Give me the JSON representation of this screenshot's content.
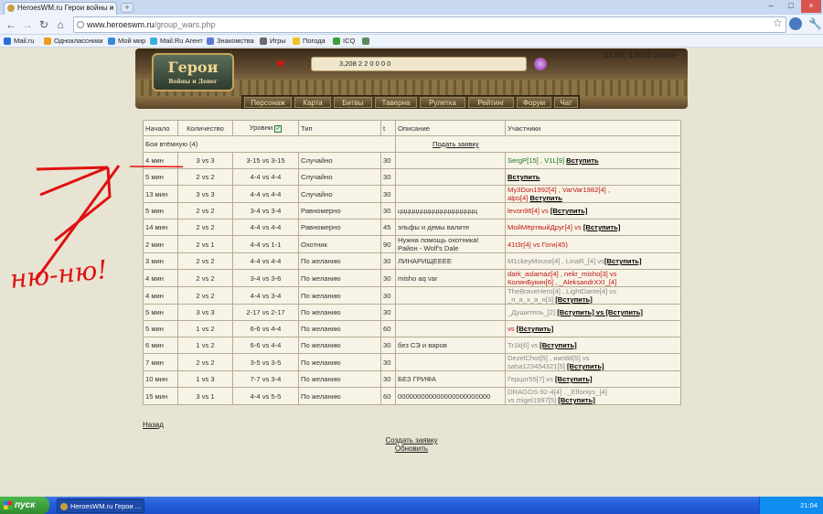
{
  "browser": {
    "tab_title": "HeroesWM.ru Герои войны и",
    "url_domain": "www.heroeswm.ru",
    "url_path": "/group_wars.php"
  },
  "bookmarks": [
    "Mail.ru",
    "Одноклассники",
    "Мой мир",
    "Mail.Ru Агент",
    "Знакомства",
    "Игры",
    "Погода",
    "ICQ"
  ],
  "header": {
    "logo": "Герои",
    "logo_sub": "Войны и Денег",
    "resources": "3,208   2   2   0   0   0   0",
    "clock": "21:03, 14815 online"
  },
  "menu": [
    "Персонаж",
    "Карта",
    "Битвы",
    "Таверна",
    "Рулетка",
    "Рейтинг",
    "Форум",
    "Чат"
  ],
  "table": {
    "headers": [
      "Начало",
      "Количество",
      "Уровни",
      "Тип",
      "t",
      "Описание",
      "Участники"
    ],
    "group_label": "Бои втёмную (4)",
    "submit_label": "Подать заявку",
    "rows": [
      {
        "start": "4 мин",
        "count": "3 vs 3",
        "levels": "3-15 vs 3-15",
        "type": "Случайно",
        "t": "30",
        "desc": "",
        "p": "SergP[15] , V1L[9] ",
        "join": "Вступить"
      },
      {
        "start": "5 мин",
        "count": "2 vs 2",
        "levels": "4-4 vs 4-4",
        "type": "Случайно",
        "t": "30",
        "desc": "",
        "p": "",
        "join": "Вступить"
      },
      {
        "start": "13 мин",
        "count": "3 vs 3",
        "levels": "4-4 vs 4-4",
        "type": "Случайно",
        "t": "30",
        "desc": "",
        "p": "My3Don1992[4] , VarVar1982[4] ,",
        "p2": "alps[4] ",
        "join": "Вступить"
      },
      {
        "start": "5 мин",
        "count": "2 vs 2",
        "levels": "3-4 vs 3-4",
        "type": "Равномерно",
        "t": "30",
        "desc": "цццццццццццццццццццц",
        "p": "levon96[4]  vs ",
        "join": "[Вступить]"
      },
      {
        "start": "14 мин",
        "count": "2 vs 2",
        "levels": "4-4 vs 4-4",
        "type": "Равномерно",
        "t": "45",
        "desc": "эльфы и демы валите",
        "p": "МойМёртвыйДруг[4]  vs ",
        "join": "[Вступить]"
      },
      {
        "start": "2 мин",
        "count": "2 vs 1",
        "levels": "4-4 vs 1-1",
        "type": "Охотник",
        "t": "90",
        "desc": "Нужна помощь охотника!",
        "desc2": "Район - Wolf's Dale",
        "p": "41t3r[4]  vs Гоги(45)",
        "join": ""
      },
      {
        "start": "3 мин",
        "count": "2 vs 2",
        "levels": "4-4 vs 4-4",
        "type": "По желанию",
        "t": "30",
        "desc": "ЛИНАРИЩЕЕЕЕ",
        "p": "M1ckeyMouse[4] , LinaR_[4]  vs",
        "join": "[Вступить]"
      },
      {
        "start": "4 мин",
        "count": "2 vs 2",
        "levels": "3-4 vs 3-6",
        "type": "По желанию",
        "t": "30",
        "desc": "misho aq var",
        "p": "dark_aslamaz[4] , nekr_misho[3]  vs",
        "p2": "КолянБукин[6] , _AleksandrXXI_[4] ",
        "join": ""
      },
      {
        "start": "4 мин",
        "count": "2 vs 2",
        "levels": "4-4 vs 3-4",
        "type": "По желанию",
        "t": "30",
        "desc": "",
        "p": "TheBraveHero[4] , LightDante[4]  vs",
        "p2": "_п_а_х_а_н[3]  ",
        "join": "[Вступить]"
      },
      {
        "start": "5 мин",
        "count": "3 vs 3",
        "levels": "2-17 vs 2-17",
        "type": "По желанию",
        "t": "30",
        "desc": "",
        "p": "_Душитель_[2]  ",
        "join": "[Вступить] vs [Вступить]"
      },
      {
        "start": "5 мин",
        "count": "1 vs 2",
        "levels": "6-6 vs 4-4",
        "type": "По желанию",
        "t": "60",
        "desc": "",
        "p": "vs ",
        "join": "[Вступить]"
      },
      {
        "start": "6 мин",
        "count": "1 vs 2",
        "levels": "6-6 vs 4-4",
        "type": "По желанию",
        "t": "30",
        "desc": "без СЭ и варов",
        "p": "Tr1k[6]  vs ",
        "join": "[Вступить]"
      },
      {
        "start": "7 мин",
        "count": "2 vs 2",
        "levels": "3-5 vs 3-5",
        "type": "По желанию",
        "t": "30",
        "desc": "",
        "p": "DezelChot[5] , иип88[5]  vs",
        "p2": "saha123454321[5]  ",
        "join": "[Вступить]"
      },
      {
        "start": "10 мин",
        "count": "1 vs 3",
        "levels": "7-7 vs 3-4",
        "type": "По желанию",
        "t": "30",
        "desc": "БЕЗ ГРИФА",
        "p": "Герцог55[7]  vs ",
        "join": "[Вступить]"
      },
      {
        "start": "15 мин",
        "count": "3 vs 1",
        "levels": "4-4 vs 5-5",
        "type": "По желанию",
        "t": "60",
        "desc": "000000000000000000000000",
        "p": "DRAGOS-92-4[4] , _Elfoniys_[4] ",
        "p2": " vs migel1997[5] ",
        "join": "[Вступить]"
      }
    ]
  },
  "links": {
    "back": "Назад",
    "create": "Создать заявку",
    "refresh": "Обновить"
  },
  "annotation": "ню-ню!",
  "taskbar": {
    "start": "пуск",
    "task": "HeroesWM.ru Герои ...",
    "time": "21:04"
  }
}
